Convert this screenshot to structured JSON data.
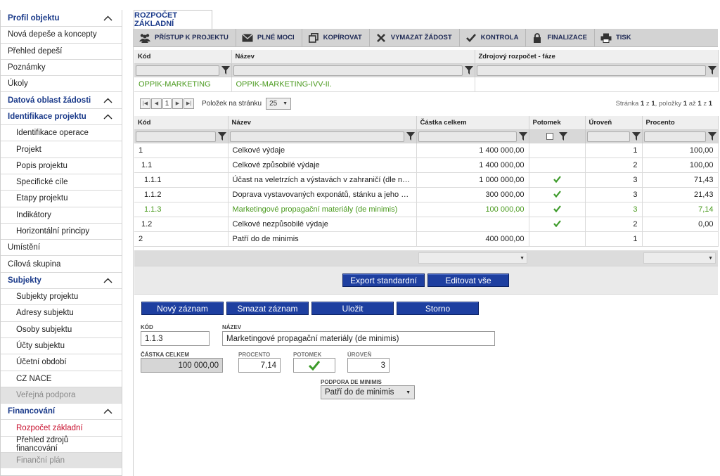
{
  "sidebar": {
    "items": [
      {
        "label": "Profil objektu",
        "type": "header"
      },
      {
        "label": "Nová depeše a koncepty",
        "type": "top"
      },
      {
        "label": "Přehled depeší",
        "type": "top"
      },
      {
        "label": "Poznámky",
        "type": "top"
      },
      {
        "label": "Úkoly",
        "type": "top"
      },
      {
        "label": "Datová oblast žádosti",
        "type": "header"
      },
      {
        "label": "Identifikace projektu",
        "type": "header"
      },
      {
        "label": "Identifikace operace",
        "type": "sub"
      },
      {
        "label": "Projekt",
        "type": "sub"
      },
      {
        "label": "Popis projektu",
        "type": "sub"
      },
      {
        "label": "Specifické cíle",
        "type": "sub"
      },
      {
        "label": "Etapy projektu",
        "type": "sub"
      },
      {
        "label": "Indikátory",
        "type": "sub"
      },
      {
        "label": "Horizontální principy",
        "type": "sub"
      },
      {
        "label": "Umístění",
        "type": "top"
      },
      {
        "label": "Cílová skupina",
        "type": "top"
      },
      {
        "label": "Subjekty",
        "type": "header"
      },
      {
        "label": "Subjekty projektu",
        "type": "sub"
      },
      {
        "label": "Adresy subjektu",
        "type": "sub"
      },
      {
        "label": "Osoby subjektu",
        "type": "sub"
      },
      {
        "label": "Účty subjektu",
        "type": "sub"
      },
      {
        "label": "Účetní období",
        "type": "sub"
      },
      {
        "label": "CZ NACE",
        "type": "sub"
      },
      {
        "label": "Veřejná podpora",
        "type": "sub-disabled"
      },
      {
        "label": "Financování",
        "type": "header"
      },
      {
        "label": "Rozpočet základní",
        "type": "sub-active"
      },
      {
        "label": "Přehled zdrojů financování",
        "type": "sub"
      },
      {
        "label": "Finanční plán",
        "type": "sub-disabled"
      }
    ]
  },
  "tab": {
    "label": "ROZPOČET ZÁKLADNÍ"
  },
  "toolbar": {
    "access": "PŘÍSTUP K PROJEKTU",
    "proxies": "PLNÉ MOCI",
    "copy": "KOPÍROVAT",
    "delete": "VYMAZAT ŽÁDOST",
    "check": "KONTROLA",
    "finalize": "FINALIZACE",
    "print": "TISK"
  },
  "top_table": {
    "headers": {
      "code": "Kód",
      "name": "Název",
      "source": "Zdrojový rozpočet - fáze"
    },
    "row": {
      "code": "OPPIK-MARKETING",
      "name": "OPPIK-MARKETING-IVV-II.",
      "source": ""
    }
  },
  "pager": {
    "current_page": "1",
    "per_page_label": "Položek na stránku",
    "per_page": "25",
    "info_page": "Stránka",
    "info_page_num": "1",
    "info_of": "z",
    "info_page_total": "1",
    "info_items": ", položky",
    "info_from": "1",
    "info_to_word": "až",
    "info_to": "1",
    "info_from_word": "z",
    "info_total": "1"
  },
  "budget_table": {
    "headers": {
      "code": "Kód",
      "name": "Název",
      "amount": "Částka celkem",
      "child": "Potomek",
      "level": "Úroveň",
      "percent": "Procento"
    },
    "rows": [
      {
        "code": "1",
        "name": "Celkové výdaje",
        "amount": "1 400 000,00",
        "child": false,
        "level": "1",
        "percent": "100,00",
        "indent": 0
      },
      {
        "code": "1.1",
        "name": "Celkové způsobilé výdaje",
        "amount": "1 400 000,00",
        "child": false,
        "level": "2",
        "percent": "100,00",
        "indent": 1
      },
      {
        "code": "1.1.1",
        "name": "Účast na veletrzích a výstavách v zahraničí (dle nařízení Ko...",
        "amount": "1 000 000,00",
        "child": true,
        "level": "3",
        "percent": "71,43",
        "indent": 2
      },
      {
        "code": "1.1.2",
        "name": "Doprava vystavovaných exponátů, stánku a jeho vybavení...",
        "amount": "300 000,00",
        "child": true,
        "level": "3",
        "percent": "21,43",
        "indent": 2
      },
      {
        "code": "1.1.3",
        "name": "Marketingové propagační materiály (de minimis)",
        "amount": "100 000,00",
        "child": true,
        "level": "3",
        "percent": "7,14",
        "indent": 2,
        "selected": true
      },
      {
        "code": "1.2",
        "name": "Celkové nezpůsobilé výdaje",
        "amount": "",
        "child": true,
        "level": "2",
        "percent": "0,00",
        "indent": 1
      },
      {
        "code": "2",
        "name": "Patří do de minimis",
        "amount": "400 000,00",
        "child": false,
        "level": "1",
        "percent": "",
        "indent": 0
      }
    ]
  },
  "actions": {
    "export": "Export standardní",
    "edit_all": "Editovat vše",
    "new_record": "Nový záznam",
    "delete_record": "Smazat záznam",
    "save": "Uložit",
    "cancel": "Storno"
  },
  "form": {
    "code_label": "KÓD",
    "code_value": "1.1.3",
    "name_label": "NÁZEV",
    "name_value": "Marketingové propagační materiály (de minimis)",
    "amount_label": "ČÁSTKA CELKEM",
    "amount_value": "100 000,00",
    "percent_label": "PROCENTO",
    "percent_value": "7,14",
    "child_label": "POTOMEK",
    "level_label": "ÚROVEŇ",
    "level_value": "3",
    "deminimis_label": "PODPORA DE MINIMIS",
    "deminimis_value": "Patří do de minimis"
  },
  "colors": {
    "accent": "#1a3a8a",
    "button": "#1e3fa0",
    "selected_row": "#4a9a1e",
    "active_nav": "#c8102e",
    "check": "#3d9b2a"
  }
}
